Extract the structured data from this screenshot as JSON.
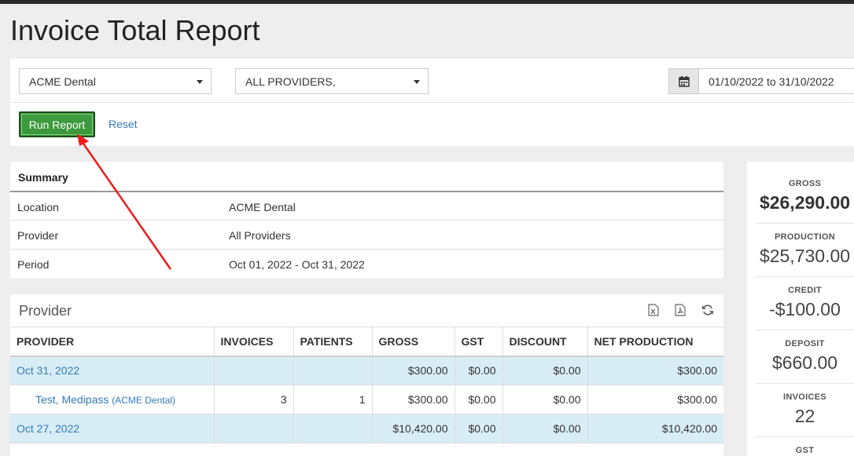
{
  "page": {
    "title": "Invoice Total Report"
  },
  "filters": {
    "location": "ACME Dental",
    "provider": "ALL PROVIDERS,",
    "date_range": "01/10/2022 to 31/10/2022",
    "run_label": "Run Report",
    "reset_label": "Reset"
  },
  "summary": {
    "heading": "Summary",
    "rows": [
      {
        "key": "Location",
        "value": "ACME Dental"
      },
      {
        "key": "Provider",
        "value": "All Providers"
      },
      {
        "key": "Period",
        "value": "Oct 01, 2022 - Oct 31, 2022"
      }
    ]
  },
  "provider_table": {
    "title": "Provider",
    "columns": [
      "PROVIDER",
      "INVOICES",
      "PATIENTS",
      "GROSS",
      "GST",
      "DISCOUNT",
      "NET PRODUCTION"
    ],
    "rows": [
      {
        "type": "date",
        "provider": "Oct 31, 2022",
        "invoices": "",
        "patients": "",
        "gross": "$300.00",
        "gst": "$0.00",
        "discount": "$0.00",
        "net": "$300.00"
      },
      {
        "type": "provider",
        "provider": "Test, Medipass",
        "location": "(ACME Dental)",
        "invoices": "3",
        "patients": "1",
        "gross": "$300.00",
        "gst": "$0.00",
        "discount": "$0.00",
        "net": "$300.00"
      },
      {
        "type": "date",
        "provider": "Oct 27, 2022",
        "invoices": "",
        "patients": "",
        "gross": "$10,420.00",
        "gst": "$0.00",
        "discount": "$0.00",
        "net": "$10,420.00"
      }
    ]
  },
  "stats": [
    {
      "label": "GROSS",
      "value": "$26,290.00"
    },
    {
      "label": "PRODUCTION",
      "value": "$25,730.00"
    },
    {
      "label": "CREDIT",
      "value": "-$100.00"
    },
    {
      "label": "DEPOSIT",
      "value": "$660.00"
    },
    {
      "label": "INVOICES",
      "value": "22"
    },
    {
      "label": "GST",
      "value": ""
    }
  ],
  "colors": {
    "run_button": "#3c9a3c",
    "link": "#337ab7",
    "date_row": "#d9edf7",
    "annotation_arrow": "#ee1c1c"
  },
  "icons": [
    "caret-down-icon",
    "calendar-icon",
    "excel-export-icon",
    "pdf-export-icon",
    "refresh-icon"
  ]
}
